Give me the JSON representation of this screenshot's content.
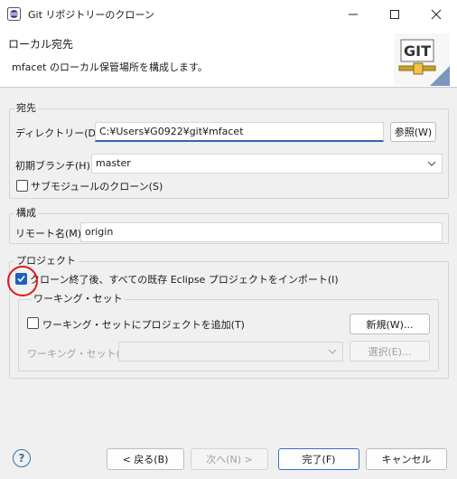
{
  "window": {
    "title": "Git リポジトリーのクローン",
    "minimize_icon": "minimize-icon",
    "maximize_icon": "maximize-icon",
    "close_icon": "close-icon"
  },
  "banner": {
    "title": "ローカル宛先",
    "description": "mfacet のローカル保管場所を構成します。",
    "graphic_text": "GIT"
  },
  "destination": {
    "group_label": "宛先",
    "directory_label": "ディレクトリー(D):",
    "directory_value": "C:¥Users¥G0922¥git¥mfacet",
    "browse_button": "参照(W)",
    "initial_branch_label": "初期ブランチ(H):",
    "initial_branch_value": "master",
    "submodule_checkbox": "サブモジュールのクローン(S)",
    "submodule_checked": false
  },
  "configuration": {
    "group_label": "構成",
    "remote_name_label": "リモート名(M):",
    "remote_name_value": "origin"
  },
  "projects": {
    "group_label": "プロジェクト",
    "import_checkbox": "クローン終了後、すべての既存 Eclipse プロジェクトをインポート(I)",
    "import_checked": true,
    "working_set_group_label": "ワーキング・セット",
    "add_to_working_set_checkbox": "ワーキング・セットにプロジェクトを追加(T)",
    "add_to_working_set_checked": false,
    "new_button": "新規(W)...",
    "working_set_label": "ワーキング・セット(O):",
    "working_set_value": "",
    "select_button": "選択(E)..."
  },
  "footer": {
    "help_symbol": "?",
    "back_button": "< 戻る(B)",
    "next_button": "次へ(N) >",
    "finish_button": "完了(F)",
    "cancel_button": "キャンセル"
  },
  "colors": {
    "accent": "#1f5fbf",
    "annotation_circle": "#e0181c"
  }
}
